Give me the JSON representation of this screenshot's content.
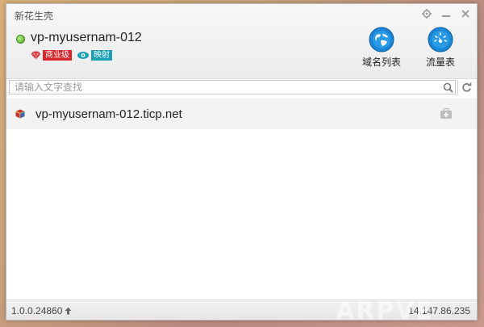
{
  "app_title": "新花生壳",
  "window_controls": {
    "settings_icon": "gear-icon",
    "minimize_icon": "minimize-icon",
    "close_icon": "close-icon"
  },
  "account": {
    "username": "vp-myusernam-012",
    "status_color": "#4aa51e",
    "badges": [
      {
        "label": "商业级",
        "icon": "diamond-icon",
        "color": "#d9262c"
      },
      {
        "label": "映射",
        "icon": "eye-icon",
        "color": "#1a9fb3"
      }
    ]
  },
  "toolbar": {
    "domain_list_label": "域名列表",
    "traffic_label": "流量表"
  },
  "search": {
    "placeholder": "请输入文字查找",
    "value": ""
  },
  "domains": [
    {
      "name": "vp-myusernam-012.ticp.net"
    }
  ],
  "footer": {
    "version": "1.0.0.24860",
    "ip": "14.147.86.235"
  },
  "watermark": "ARPVE"
}
